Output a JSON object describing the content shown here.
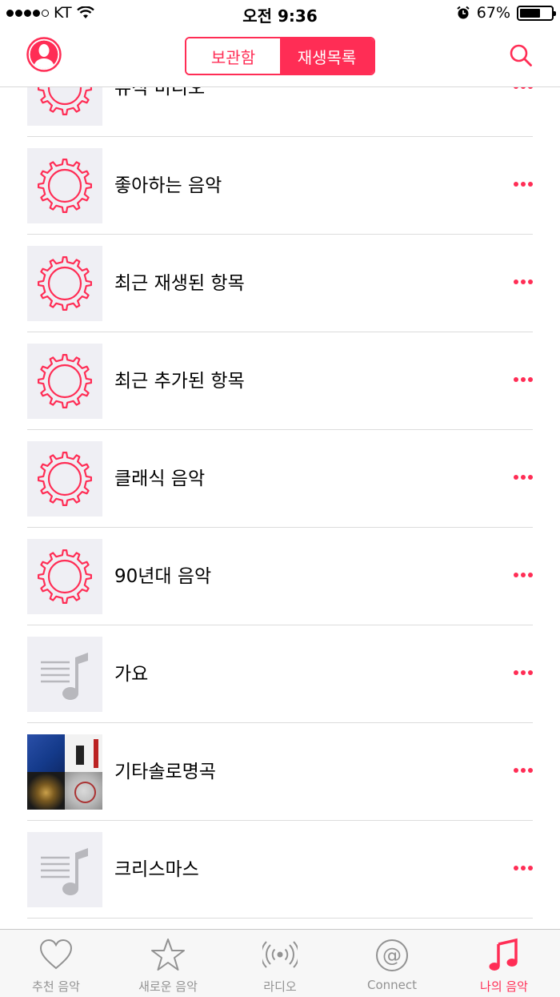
{
  "status_bar": {
    "carrier": "KT",
    "time": "오전 9:36",
    "battery": "67%",
    "battery_level": 0.67
  },
  "header": {
    "segments": [
      "보관함",
      "재생목록"
    ],
    "selected_segment": "재생목록",
    "avatar_icon": "profile-icon",
    "search_icon": "search-icon"
  },
  "playlists": [
    {
      "title": "뮤직 비디오",
      "art": "smart-playlist-gear"
    },
    {
      "title": "좋아하는 음악",
      "art": "smart-playlist-gear"
    },
    {
      "title": "최근 재생된 항목",
      "art": "smart-playlist-gear"
    },
    {
      "title": "최근 추가된 항목",
      "art": "smart-playlist-gear"
    },
    {
      "title": "클래식 음악",
      "art": "smart-playlist-gear"
    },
    {
      "title": "90년대 음악",
      "art": "smart-playlist-gear"
    },
    {
      "title": "가요",
      "art": "playlist-note"
    },
    {
      "title": "기타솔로명곡",
      "art": "album-mosaic"
    },
    {
      "title": "크리스마스",
      "art": "playlist-note"
    }
  ],
  "tab_bar": {
    "tabs": [
      {
        "label": "추천 음악",
        "icon": "heart-icon"
      },
      {
        "label": "새로운 음악",
        "icon": "star-icon"
      },
      {
        "label": "라디오",
        "icon": "radio-icon"
      },
      {
        "label": "Connect",
        "icon": "at-icon"
      },
      {
        "label": "나의 음악",
        "icon": "music-note-icon"
      }
    ],
    "active": "나의 음악"
  },
  "colors": {
    "accent": "#ff2d55",
    "art_background": "#efeff4",
    "tab_inactive": "#929292"
  }
}
